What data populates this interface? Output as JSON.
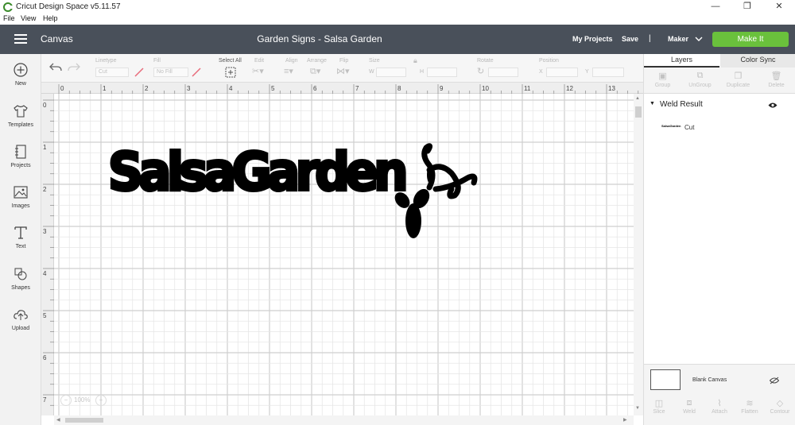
{
  "window": {
    "title": "Cricut Design Space  v5.11.57",
    "min": "—",
    "restore": "❐",
    "close": "✕"
  },
  "menu": [
    "File",
    "View",
    "Help"
  ],
  "header": {
    "canvas_label": "Canvas",
    "project_title": "Garden Signs - Salsa Garden",
    "my_projects": "My Projects",
    "save": "Save",
    "separator": "|",
    "machine": "Maker",
    "make_it": "Make It"
  },
  "sidebar": [
    {
      "label": "New",
      "icon": "plus-circle-icon"
    },
    {
      "label": "Templates",
      "icon": "shirt-icon"
    },
    {
      "label": "Projects",
      "icon": "notebook-icon"
    },
    {
      "label": "Images",
      "icon": "image-icon"
    },
    {
      "label": "Text",
      "icon": "text-T-icon"
    },
    {
      "label": "Shapes",
      "icon": "shapes-icon"
    },
    {
      "label": "Upload",
      "icon": "cloud-upload-icon"
    }
  ],
  "toolbar": {
    "linetype_label": "Linetype",
    "linetype_value": "Cut",
    "fill_label": "Fill",
    "fill_value": "No Fill",
    "select_all": "Select All",
    "edit": "Edit",
    "align": "Align",
    "arrange": "Arrange",
    "flip": "Flip",
    "size": "Size",
    "w": "W",
    "h": "H",
    "rotate": "Rotate",
    "position": "Position",
    "x": "X",
    "y": "Y"
  },
  "ruler": {
    "top": [
      "0",
      "1",
      "2",
      "3",
      "4",
      "5",
      "6",
      "7",
      "8",
      "9",
      "10",
      "11",
      "12",
      "13"
    ],
    "left": [
      "0",
      "1",
      "2",
      "3",
      "4",
      "5",
      "6",
      "7"
    ]
  },
  "canvas": {
    "design_text": "SalsaGarden",
    "zoom": "100%",
    "zoom_minus": "−",
    "zoom_plus": "+"
  },
  "panel": {
    "tabs": [
      "Layers",
      "Color Sync"
    ],
    "layer_tools": [
      "Group",
      "UnGroup",
      "Duplicate",
      "Delete"
    ],
    "group_name": "Weld Result",
    "layer_thumb": "SalsaGarden",
    "layer_name": "Cut",
    "blank_canvas": "Blank Canvas",
    "bottom_tools": [
      "Slice",
      "Weld",
      "Attach",
      "Flatten",
      "Contour"
    ]
  },
  "colors": {
    "header": "#49505a",
    "make_it": "#6ac13c",
    "grid_minor": "#e6e6e6",
    "grid_major": "#cfcfcf"
  }
}
